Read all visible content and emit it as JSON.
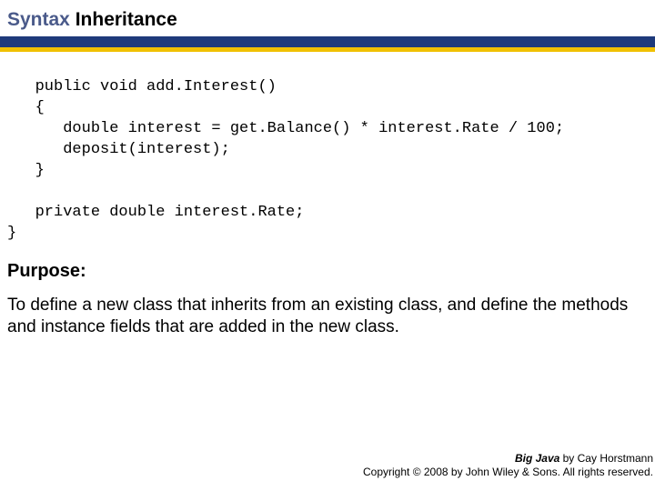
{
  "header": {
    "prefix": "Syntax",
    "topic": "Inheritance"
  },
  "code": "   public void add.Interest()\n   {\n      double interest = get.Balance() * interest.Rate / 100;\n      deposit(interest);\n   }\n\n   private double interest.Rate;\n}",
  "purpose": {
    "heading": "Purpose:",
    "text": "To define a new class that inherits from an existing class, and define the methods and instance fields that are added in the new class."
  },
  "footer": {
    "book": "Big Java",
    "by": " by Cay Horstmann",
    "copyright": "Copyright © 2008 by John Wiley & Sons.  All rights reserved."
  }
}
